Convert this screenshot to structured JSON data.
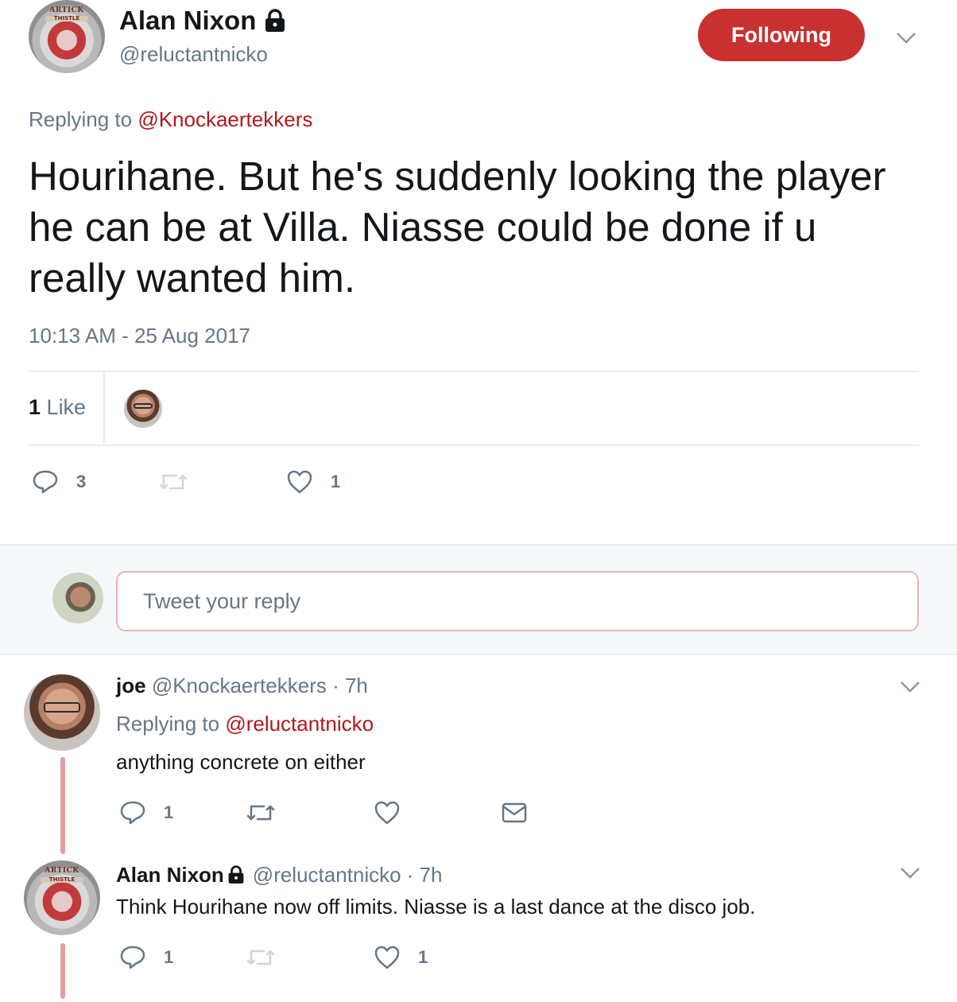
{
  "tweet": {
    "author_name": "Alan Nixon",
    "author_handle": "@reluctantnicko",
    "avatar_text_top": "ARTICK",
    "avatar_text_sub": "THISTLE",
    "follow_label": "Following",
    "replying_prefix": "Replying to",
    "replying_to": "@Knockaertekkers",
    "text": "Hourihane. But he's suddenly looking the player he can be at Villa. Niasse could be done if u really wanted him.",
    "timestamp": "10:13 AM - 25 Aug 2017",
    "likes_count": "1",
    "likes_label": "Like",
    "reply_count": "3",
    "like_count": "1"
  },
  "composer": {
    "placeholder": "Tweet your reply"
  },
  "replies": [
    {
      "author_name": "joe",
      "author_handle": "@Knockaertekkers",
      "time": "· 7h",
      "replying_prefix": "Replying to",
      "replying_to": "@reluctantnicko",
      "text": "anything concrete on either",
      "reply_count": "1"
    },
    {
      "author_name": "Alan Nixon",
      "author_handle": "@reluctantnicko",
      "time": "· 7h",
      "avatar_text_top": "ARTICK",
      "avatar_text_sub": "THISTLE",
      "text": "Think Hourihane now off limits. Niasse is a last dance at the disco job.",
      "reply_count": "1",
      "like_count": "1"
    }
  ],
  "colors": {
    "accent": "#c8312f",
    "link": "#b0191d",
    "muted": "#657786",
    "thread_line": "#e29e9f"
  }
}
